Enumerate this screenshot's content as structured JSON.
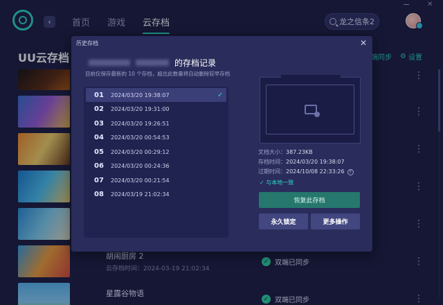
{
  "topbar": {
    "nav": [
      "首页",
      "游戏",
      "云存档"
    ],
    "active_nav": "云存档",
    "search_value": "龙之信条2"
  },
  "page": {
    "title": "UU云存档",
    "sync_link": "端同步",
    "settings_label": "设置"
  },
  "games": [
    {
      "name": "",
      "time": "",
      "status": ""
    },
    {
      "name": "",
      "time": "",
      "status": ""
    },
    {
      "name": "",
      "time": "",
      "status": ""
    },
    {
      "name": "",
      "time": "",
      "status": ""
    },
    {
      "name": "",
      "time": "",
      "status": ""
    },
    {
      "name": "胡闹厨房 2",
      "time": "云存档时间：2024-03-19 21:02:34",
      "status": "双端已同步"
    },
    {
      "name": "星露谷物语",
      "time": "",
      "status": "双端已同步"
    }
  ],
  "modal": {
    "header": "历史存档",
    "title_suffix": "的存档记录",
    "subtitle": "目前仅保存最新的 10 个存档，超出此数量将自动删除较早存档",
    "saves": [
      {
        "no": "01",
        "time": "2024/03/20 19:38:07",
        "selected": true
      },
      {
        "no": "02",
        "time": "2024/03/20 19:31:00",
        "selected": false
      },
      {
        "no": "03",
        "time": "2024/03/20 19:26:51",
        "selected": false
      },
      {
        "no": "04",
        "time": "2024/03/20 00:54:53",
        "selected": false
      },
      {
        "no": "05",
        "time": "2024/03/20 00:29:12",
        "selected": false
      },
      {
        "no": "06",
        "time": "2024/03/20 00:24:36",
        "selected": false
      },
      {
        "no": "07",
        "time": "2024/03/20 00:21:54",
        "selected": false
      },
      {
        "no": "08",
        "time": "2024/03/19 21:02:34",
        "selected": false
      }
    ],
    "details": {
      "size_label": "文档大小：",
      "size_value": "387.23KB",
      "save_time_label": "存档时间：",
      "save_time_value": "2024/03/20 19:38:07",
      "expire_label": "过期时间：",
      "expire_value": "2024/10/08 22:33:26",
      "local_status": "与本地一致"
    },
    "buttons": {
      "restore": "恢复此存档",
      "lock": "永久锁定",
      "more": "更多操作"
    }
  },
  "colors": {
    "accent": "#2fd6c4",
    "background": "#1c1e41",
    "modal": "#2a2c5b"
  }
}
